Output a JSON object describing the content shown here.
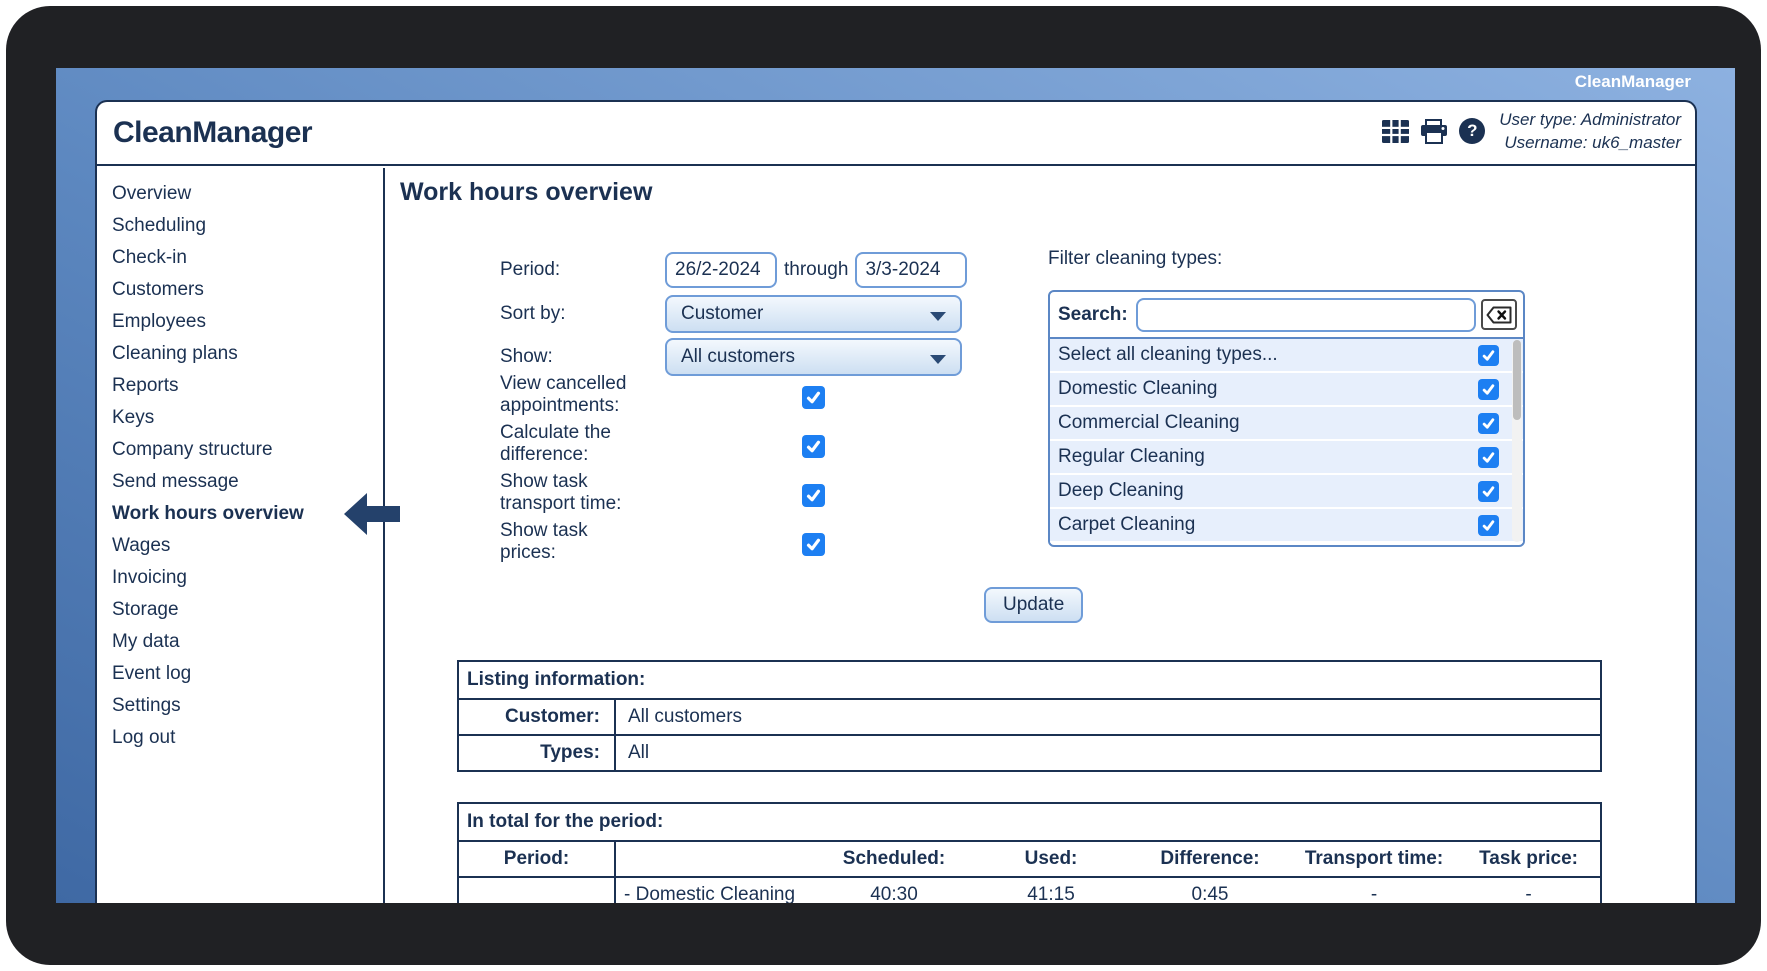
{
  "brand": {
    "top_bar_label": "CleanManager",
    "logo": "CleanManager"
  },
  "header": {
    "user_type": "User type: Administrator",
    "username": "Username: uk6_master",
    "icons": [
      "grid-icon",
      "print-icon",
      "help-icon"
    ]
  },
  "sidebar": {
    "items": [
      {
        "label": "Overview",
        "active": false
      },
      {
        "label": "Scheduling",
        "active": false
      },
      {
        "label": "Check-in",
        "active": false
      },
      {
        "label": "Customers",
        "active": false
      },
      {
        "label": "Employees",
        "active": false
      },
      {
        "label": "Cleaning plans",
        "active": false
      },
      {
        "label": "Reports",
        "active": false
      },
      {
        "label": "Keys",
        "active": false
      },
      {
        "label": "Company structure",
        "active": false
      },
      {
        "label": "Send message",
        "active": false
      },
      {
        "label": "Work hours overview",
        "active": true
      },
      {
        "label": "Wages",
        "active": false
      },
      {
        "label": "Invoicing",
        "active": false
      },
      {
        "label": "Storage",
        "active": false
      },
      {
        "label": "My data",
        "active": false
      },
      {
        "label": "Event log",
        "active": false
      },
      {
        "label": "Settings",
        "active": false
      },
      {
        "label": "Log out",
        "active": false
      }
    ]
  },
  "page": {
    "title": "Work hours overview"
  },
  "form": {
    "period_label": "Period:",
    "period_from": "26/2-2024",
    "period_through_label": "through",
    "period_to": "3/3-2024",
    "sort_by_label": "Sort by:",
    "sort_by_value": "Customer",
    "show_label": "Show:",
    "show_value": "All customers",
    "checkboxes": [
      {
        "label": "View cancelled appointments:",
        "checked": true
      },
      {
        "label": "Calculate the difference:",
        "checked": true
      },
      {
        "label": "Show task transport time:",
        "checked": true
      },
      {
        "label": "Show task prices:",
        "checked": true
      }
    ],
    "update_label": "Update"
  },
  "filter": {
    "heading": "Filter cleaning types:",
    "search_label": "Search:",
    "search_value": "",
    "items": [
      {
        "label": "Select all cleaning types...",
        "checked": true
      },
      {
        "label": "Domestic Cleaning",
        "checked": true
      },
      {
        "label": "Commercial Cleaning",
        "checked": true
      },
      {
        "label": "Regular Cleaning",
        "checked": true
      },
      {
        "label": "Deep Cleaning",
        "checked": true
      },
      {
        "label": "Carpet Cleaning",
        "checked": true
      }
    ]
  },
  "listing_info": {
    "title": "Listing information:",
    "rows": [
      {
        "label": "Customer:",
        "value": "All customers"
      },
      {
        "label": "Types:",
        "value": "All"
      }
    ]
  },
  "totals": {
    "title": "In total for the period:",
    "columns": {
      "period": "Period:",
      "scheduled": "Scheduled:",
      "used": "Used:",
      "difference": "Difference:",
      "transport": "Transport time:",
      "price": "Task price:"
    },
    "rows": [
      {
        "name": "- Domestic Cleaning",
        "scheduled": "40:30",
        "used": "41:15",
        "difference": "0:45",
        "transport": "-",
        "price": "-"
      }
    ]
  },
  "colors": {
    "navy": "#1b3152",
    "frame": "#202124",
    "cbblue": "#1d7ff2",
    "ctlborder": "#6f9cd8",
    "bluelight": "#8db1e0",
    "bluedark": "#3f69a4",
    "rowbg": "#e7effc"
  }
}
